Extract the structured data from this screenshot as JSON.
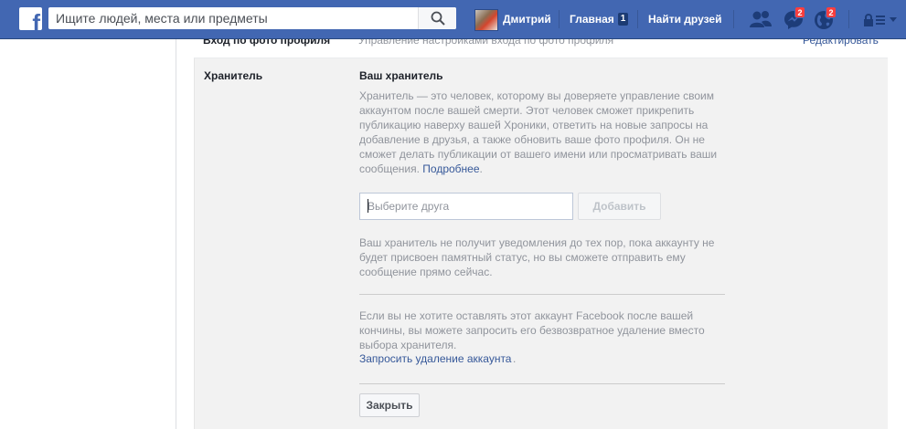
{
  "header": {
    "search_placeholder": "Ищите людей, места или предметы",
    "user_name": "Дмитрий",
    "home_label": "Главная",
    "home_count": "1",
    "find_friends_label": "Найти друзей",
    "messages_badge": "2",
    "notifications_badge": "2"
  },
  "settings": {
    "top_row": {
      "label": "Вход по фото профиля",
      "description": "Управление настройками входа по фото профиля",
      "edit_label": "Редактировать"
    },
    "legacy_contact": {
      "label": "Хранитель",
      "title": "Ваш хранитель",
      "description": "Хранитель — это человек, которому вы доверяете управление своим аккаунтом после вашей смерти. Этот человек сможет прикрепить публикацию наверху вашей Хроники, ответить на новые запросы на добавление в друзья, а также обновить ваше фото профиля. Он не сможет делать публикации от вашего имени или просматривать ваши сообщения.",
      "learn_more": "Подробнее",
      "friend_input_placeholder": "Выберите друга",
      "add_button": "Добавить",
      "notice": "Ваш хранитель не получит уведомления до тех пор, пока аккаунту не будет присвоен памятный статус, но вы сможете отправить ему сообщение прямо сейчас.",
      "deletion_text": "Если вы не хотите оставлять этот аккаунт Facebook после вашей кончины, вы можете запросить его безвозвратное удаление вместо выбора хранителя.",
      "deletion_link": "Запросить удаление аккаунта",
      "close_button": "Закрыть"
    }
  },
  "colors": {
    "brand": "#4267b2",
    "link": "#365899",
    "badge": "#fa3e3e",
    "panel_bg": "#f2f2f2"
  },
  "icons": [
    "facebook-logo",
    "search-icon",
    "friends-icon",
    "messenger-icon",
    "globe-icon",
    "lock-icon",
    "dropdown-triangle-icon"
  ]
}
